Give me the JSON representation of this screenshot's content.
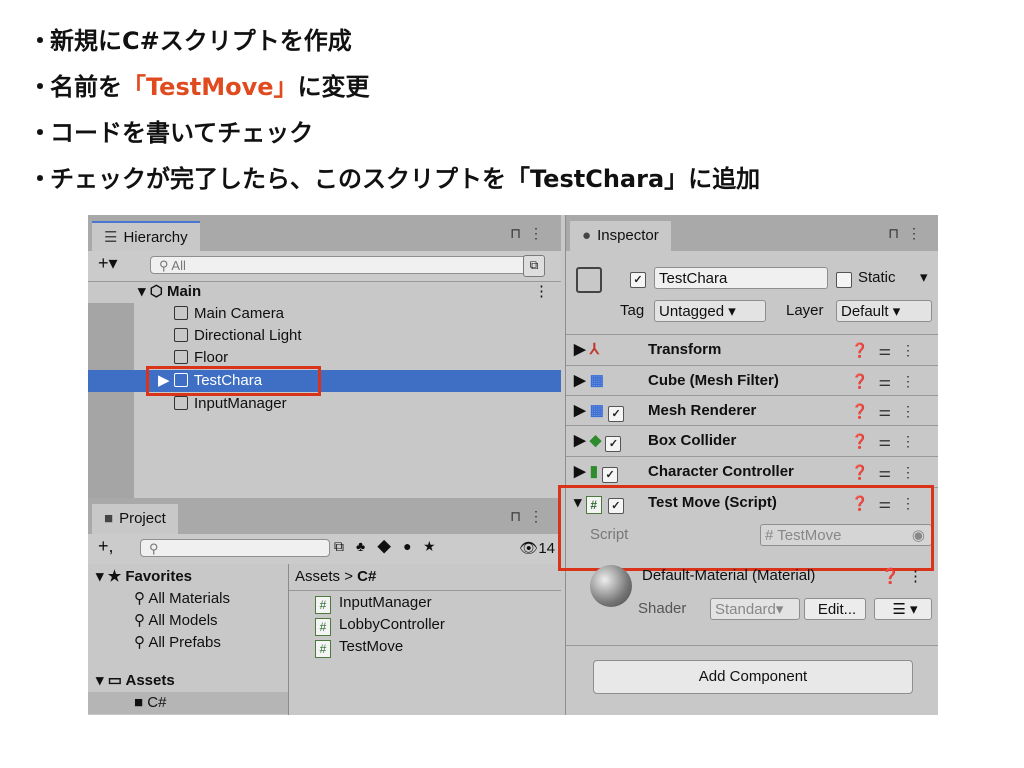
{
  "slide": {
    "bullets": [
      {
        "dot": "・",
        "text": "新規にC#スクリプトを作成"
      },
      {
        "dot": "・",
        "pre": "名前を",
        "highlight": "「TestMove」",
        "post": "に変更"
      },
      {
        "dot": "・",
        "text": "コードを書いてチェック"
      },
      {
        "dot": "・",
        "text": "チェックが完了したら、このスクリプトを「TestChara」に追加"
      }
    ],
    "highlight_color": "#e04a1f"
  },
  "hierarchy": {
    "tab_label": "Hierarchy",
    "search_placeholder": "All",
    "scene": "Main",
    "items": [
      "Main Camera",
      "Directional Light",
      "Floor",
      "TestChara",
      "InputManager"
    ],
    "selected": "TestChara"
  },
  "project": {
    "tab_label": "Project",
    "visible_count": "14",
    "favorites_label": "Favorites",
    "favorites": [
      "All Materials",
      "All Models",
      "All Prefabs"
    ],
    "assets_label": "Assets",
    "folder": "C#",
    "breadcrumb_root": "Assets",
    "breadcrumb_sep": ">",
    "breadcrumb_current": "C#",
    "files": [
      "InputManager",
      "LobbyController",
      "TestMove"
    ]
  },
  "inspector": {
    "tab_label": "Inspector",
    "object_name": "TestChara",
    "static_label": "Static",
    "tag_label": "Tag",
    "tag_value": "Untagged",
    "layer_label": "Layer",
    "layer_value": "Default",
    "components": [
      "Transform",
      "Cube (Mesh Filter)",
      "Mesh Renderer",
      "Box Collider",
      "Character Controller",
      "Test Move (Script)"
    ],
    "script_label": "Script",
    "script_value": "TestMove",
    "material_name": "Default-Material (Material)",
    "shader_label": "Shader",
    "shader_value": "Standard",
    "edit_label": "Edit...",
    "add_component": "Add Component"
  },
  "colors": {
    "selection": "#3f6fc4",
    "annotation": "#d9331a"
  }
}
